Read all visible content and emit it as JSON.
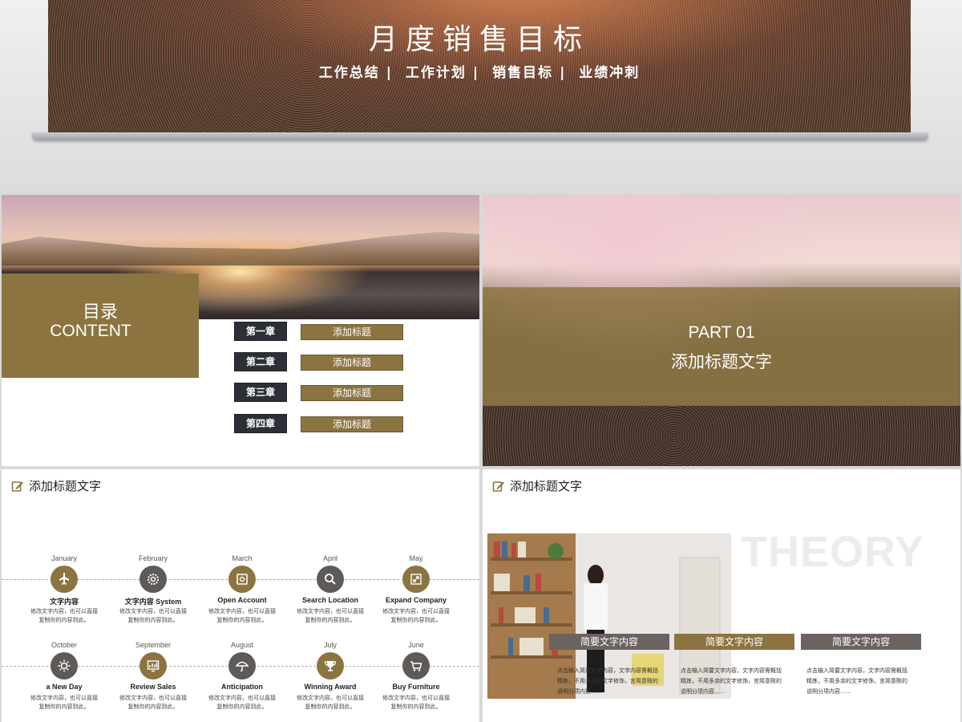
{
  "top": {
    "title": "月度销售目标",
    "subtitle_items": [
      "工作总结",
      "工作计划",
      "销售目标",
      "业绩冲刺"
    ],
    "separator": "|"
  },
  "slide1": {
    "title": "目录",
    "subtitle": "CONTENT",
    "toc": [
      {
        "chapter": "第一章",
        "title": "添加标题"
      },
      {
        "chapter": "第二章",
        "title": "添加标题"
      },
      {
        "chapter": "第三章",
        "title": "添加标题"
      },
      {
        "chapter": "第四章",
        "title": "添加标题"
      }
    ]
  },
  "slide2": {
    "part": "PART 01",
    "title": "添加标题文字"
  },
  "slide3": {
    "header": "添加标题文字",
    "timeline_top": [
      {
        "month": "January",
        "name": "文字内容",
        "desc": [
          "修改文字内容，也可以直接",
          "复制你的内容到此。"
        ],
        "icon": "airplane-icon",
        "color": "#8c7441"
      },
      {
        "month": "February",
        "name": "文字内容 System",
        "desc": [
          "修改文字内容，也可以直接",
          "复制你的内容到此。"
        ],
        "icon": "gear-icon",
        "color": "#5d5a58"
      },
      {
        "month": "March",
        "name": "Open Account",
        "desc": [
          "修改文字内容，也可以直接",
          "复制你的内容到此。"
        ],
        "icon": "safe-icon",
        "color": "#8c7441"
      },
      {
        "month": "April",
        "name": "Search Location",
        "desc": [
          "修改文字内容，也可以直接",
          "复制你的内容到此。"
        ],
        "icon": "search-icon",
        "color": "#5d5a58"
      },
      {
        "month": "May",
        "name": "Expand Company",
        "desc": [
          "修改文字内容，也可以直接",
          "复制你的内容到此。"
        ],
        "icon": "expand-icon",
        "color": "#8c7441"
      }
    ],
    "timeline_bottom": [
      {
        "month": "October",
        "name": "a New Day",
        "desc": [
          "修改文字内容，也可以直接",
          "复制你的内容到此。"
        ],
        "icon": "sun-icon",
        "color": "#5d5a58"
      },
      {
        "month": "September",
        "name": "Review Sales",
        "desc": [
          "修改文字内容，也可以直接",
          "复制你的内容到此。"
        ],
        "icon": "monitor-chart-icon",
        "color": "#8c7441"
      },
      {
        "month": "August",
        "name": "Anticipation",
        "desc": [
          "修改文字内容，也可以直接",
          "复制你的内容到此。"
        ],
        "icon": "umbrella-icon",
        "color": "#5d5a58"
      },
      {
        "month": "July",
        "name": "Winning Award",
        "desc": [
          "修改文字内容，也可以直接",
          "复制你的内容到此。"
        ],
        "icon": "trophy-icon",
        "color": "#8c7441"
      },
      {
        "month": "June",
        "name": "Buy Furniture",
        "desc": [
          "修改文字内容，也可以直接",
          "复制你的内容到此。"
        ],
        "icon": "cart-icon",
        "color": "#5d5a58"
      }
    ]
  },
  "slide4": {
    "header": "添加标题文字",
    "watermark": "THEORY",
    "columns": [
      {
        "tag": "简要文字内容",
        "color": "#6b6360",
        "desc": [
          "点击输入简要文字内容，文字内容需概括",
          "精炼，不用多余的文字修饰，言简意赅的",
          "说明分项内容……"
        ]
      },
      {
        "tag": "简要文字内容",
        "color": "#8c7441",
        "desc": [
          "点击输入简要文字内容，文字内容需概括",
          "精炼，不用多余的文字修饰，言简意赅的",
          "说明分项内容……"
        ]
      },
      {
        "tag": "简要文字内容",
        "color": "#6b6360",
        "desc": [
          "点击输入简要文字内容，文字内容需概括",
          "精炼，不用多余的文字修饰，言简意赅的",
          "说明分项内容……"
        ]
      }
    ]
  }
}
